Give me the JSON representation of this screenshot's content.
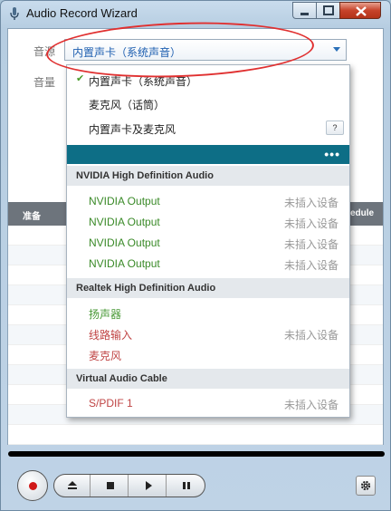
{
  "window": {
    "title": "Audio Record Wizard"
  },
  "form": {
    "source_label": "音源",
    "volume_label": "音量",
    "source_value": "内置声卡（系统声音）"
  },
  "background_table": {
    "col_ready": "准备",
    "col_schedule": "edule"
  },
  "dropdown": {
    "options": [
      {
        "label": "内置声卡（系统声音）",
        "checked": true
      },
      {
        "label": "麦克风（话筒）",
        "checked": false
      },
      {
        "label": "内置声卡及麦克风",
        "checked": false,
        "help": "?"
      }
    ],
    "more": "•••",
    "groups": [
      {
        "title": "NVIDIA High Definition Audio",
        "devices": [
          {
            "name": "NVIDIA Output",
            "status": "未插入设备"
          },
          {
            "name": "NVIDIA Output",
            "status": "未插入设备"
          },
          {
            "name": "NVIDIA Output",
            "status": "未插入设备"
          },
          {
            "name": "NVIDIA Output",
            "status": "未插入设备"
          }
        ]
      },
      {
        "title": "Realtek High Definition Audio",
        "devices": [
          {
            "name": "扬声器",
            "status": ""
          },
          {
            "name": "线路输入",
            "status": "未插入设备"
          },
          {
            "name": "麦克风",
            "status": ""
          }
        ]
      },
      {
        "title": "Virtual Audio Cable",
        "devices": [
          {
            "name": "S/PDIF 1",
            "status": "未插入设备"
          }
        ]
      }
    ]
  },
  "colors": {
    "accent_teal": "#0d6e86",
    "annotation_red": "#e03030",
    "device_green": "#3a8a28",
    "device_red": "#c04545"
  },
  "icons": [
    "app-icon",
    "minimize-icon",
    "maximize-icon",
    "close-icon",
    "chevron-down-icon",
    "checkmark-icon",
    "record-icon",
    "eject-icon",
    "stop-icon",
    "play-icon",
    "pause-icon",
    "gear-icon"
  ]
}
